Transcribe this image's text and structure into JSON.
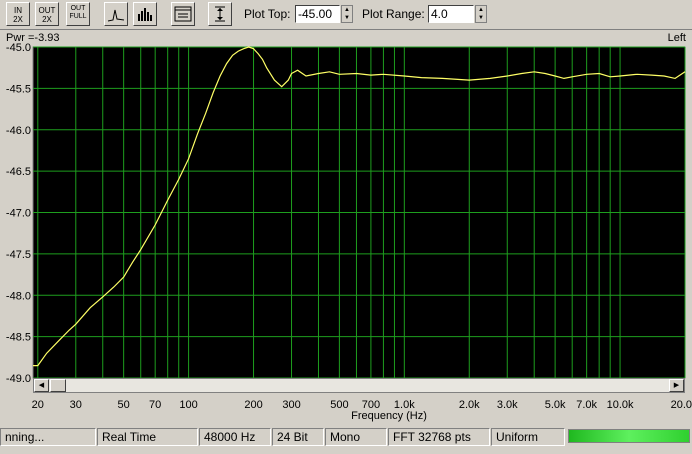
{
  "toolbar": {
    "buttons": [
      {
        "name": "in-2x-button",
        "line1": "IN",
        "line2": "2X"
      },
      {
        "name": "out-2x-button",
        "line1": "OUT",
        "line2": "2X"
      },
      {
        "name": "out-full-button",
        "line1": "OUT",
        "line2": "FULL"
      }
    ],
    "plot_top_label": "Plot Top:",
    "plot_top_value": "-45.00",
    "plot_range_label": "Plot Range:",
    "plot_range_value": "4.0"
  },
  "plot": {
    "power_readout": "Pwr =-3.93",
    "channel": "Left"
  },
  "status": {
    "mode": "nning...",
    "view": "Real Time",
    "sample_rate": "48000 Hz",
    "bit_depth": "24 Bit",
    "channels": "Mono",
    "fft": "FFT 32768 pts",
    "window": "Uniform"
  },
  "colors": {
    "plot_bg": "#000000",
    "grid": "#1e9e1e",
    "trace": "#ffff66",
    "meter": "#3adf3a"
  },
  "chart_data": {
    "type": "line",
    "title": "",
    "xlabel": "Frequency (Hz)",
    "ylabel": "",
    "x_scale": "log",
    "xlim": [
      19,
      20000
    ],
    "ylim": [
      -49.0,
      -45.0
    ],
    "y_ticks": [
      "-45.0",
      "-45.5",
      "-46.0",
      "-46.5",
      "-47.0",
      "-47.5",
      "-48.0",
      "-48.5",
      "-49.0"
    ],
    "x_ticks": [
      {
        "v": 20,
        "label": "20"
      },
      {
        "v": 30,
        "label": "30"
      },
      {
        "v": 50,
        "label": "50"
      },
      {
        "v": 70,
        "label": "70"
      },
      {
        "v": 100,
        "label": "100"
      },
      {
        "v": 200,
        "label": "200"
      },
      {
        "v": 300,
        "label": "300"
      },
      {
        "v": 500,
        "label": "500"
      },
      {
        "v": 700,
        "label": "700"
      },
      {
        "v": 1000,
        "label": "1.0k"
      },
      {
        "v": 2000,
        "label": "2.0k"
      },
      {
        "v": 3000,
        "label": "3.0k"
      },
      {
        "v": 5000,
        "label": "5.0k"
      },
      {
        "v": 7000,
        "label": "7.0k"
      },
      {
        "v": 10000,
        "label": "10.0k"
      },
      {
        "v": 20000,
        "label": "20.0"
      }
    ],
    "grid": true,
    "series": [
      {
        "x": [
          19,
          20,
          22,
          25,
          28,
          30,
          35,
          40,
          45,
          50,
          55,
          60,
          70,
          80,
          90,
          100,
          110,
          120,
          130,
          140,
          150,
          160,
          170,
          180,
          190,
          200,
          210,
          220,
          230,
          250,
          270,
          290,
          300,
          320,
          350,
          400,
          450,
          500,
          600,
          700,
          800,
          1000,
          1200,
          1500,
          2000,
          2500,
          3000,
          3500,
          4000,
          4500,
          5000,
          5500,
          6000,
          7000,
          8000,
          9000,
          10000,
          12000,
          14000,
          16000,
          18000,
          20000
        ],
        "y": [
          -48.85,
          -48.85,
          -48.7,
          -48.55,
          -48.42,
          -48.35,
          -48.15,
          -48.02,
          -47.9,
          -47.78,
          -47.6,
          -47.45,
          -47.15,
          -46.85,
          -46.6,
          -46.35,
          -46.05,
          -45.8,
          -45.55,
          -45.35,
          -45.2,
          -45.1,
          -45.05,
          -45.02,
          -45.0,
          -45.02,
          -45.08,
          -45.15,
          -45.25,
          -45.4,
          -45.48,
          -45.4,
          -45.32,
          -45.28,
          -45.35,
          -45.32,
          -45.3,
          -45.33,
          -45.32,
          -45.34,
          -45.33,
          -45.35,
          -45.37,
          -45.38,
          -45.4,
          -45.38,
          -45.35,
          -45.32,
          -45.3,
          -45.32,
          -45.35,
          -45.38,
          -45.36,
          -45.33,
          -45.32,
          -45.36,
          -45.35,
          -45.33,
          -45.34,
          -45.35,
          -45.38,
          -45.3
        ]
      }
    ]
  }
}
